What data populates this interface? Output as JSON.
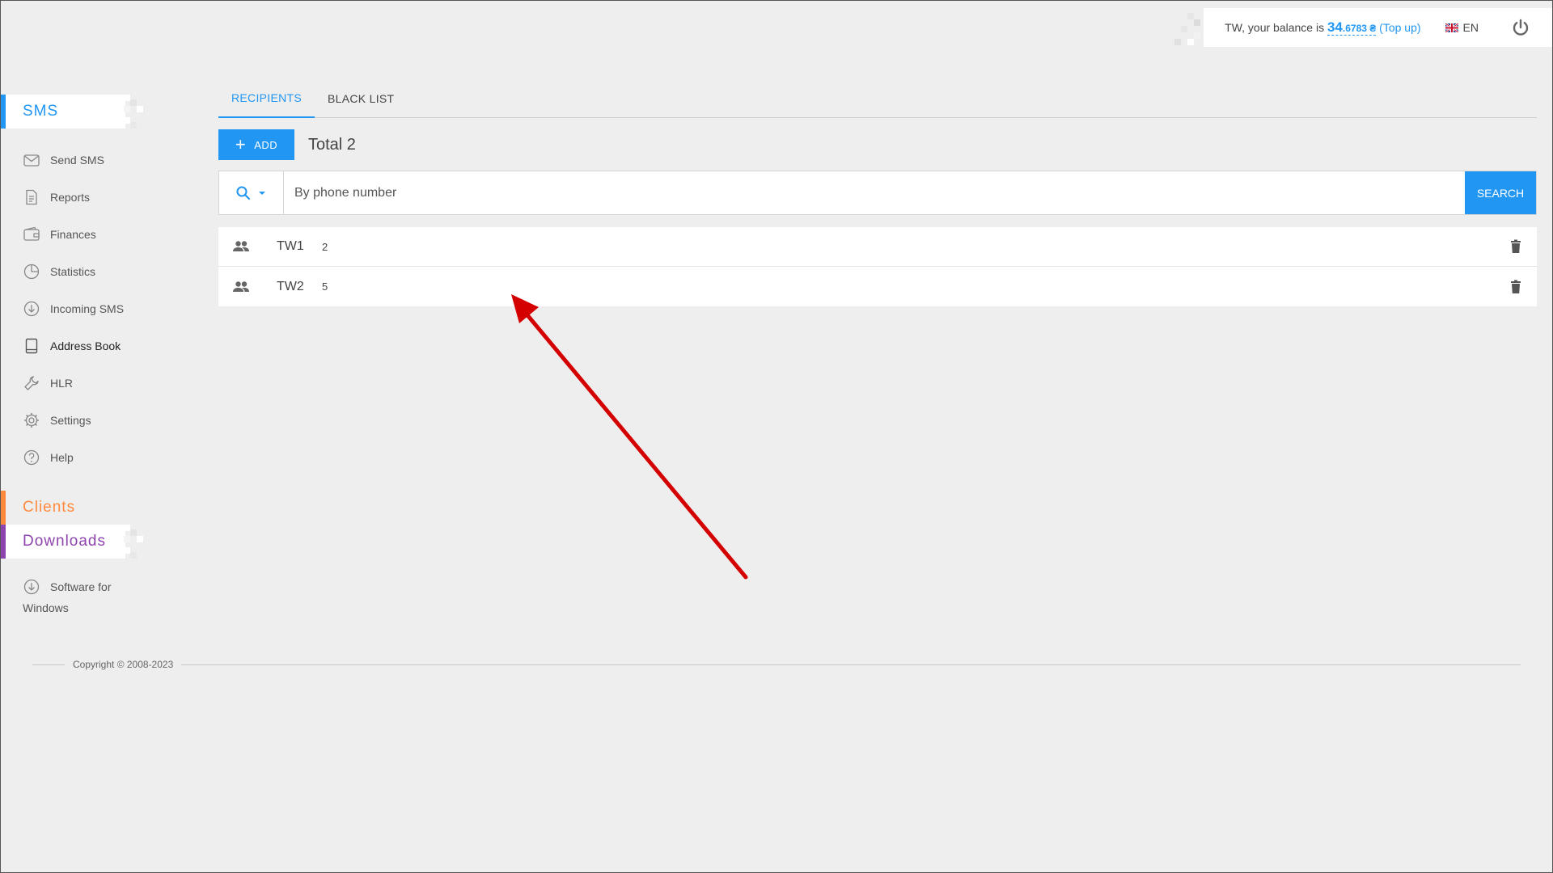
{
  "header": {
    "balance_prefix": "TW, your balance is ",
    "balance_int": "34",
    "balance_dec": ".6783 ₴",
    "topup_open": " (",
    "topup_label": "Top up",
    "topup_close": ")",
    "language": "EN",
    "icons": {
      "flag": "uk-flag-icon",
      "logout": "power-icon"
    }
  },
  "sidebar": {
    "sections": [
      {
        "label": "SMS",
        "color": "#2196f3"
      },
      {
        "label": "Clients",
        "color": "#ff8a3d"
      },
      {
        "label": "Downloads",
        "color": "#8e44ad"
      }
    ],
    "sms_items": [
      {
        "label": "Send SMS",
        "icon": "envelope-icon"
      },
      {
        "label": "Reports",
        "icon": "document-icon"
      },
      {
        "label": "Finances",
        "icon": "wallet-icon"
      },
      {
        "label": "Statistics",
        "icon": "pie-chart-icon"
      },
      {
        "label": "Incoming SMS",
        "icon": "incoming-icon"
      },
      {
        "label": "Address Book",
        "icon": "address-book-icon",
        "active": true
      },
      {
        "label": "HLR",
        "icon": "wrench-icon"
      },
      {
        "label": "Settings",
        "icon": "gear-icon"
      },
      {
        "label": "Help",
        "icon": "help-icon"
      }
    ],
    "downloads_items": [
      {
        "label_line1": "Software for",
        "label_line2": "Windows",
        "icon": "download-icon"
      }
    ]
  },
  "main": {
    "tabs": [
      {
        "label": "RECIPIENTS",
        "active": true
      },
      {
        "label": "BLACK LIST",
        "active": false
      }
    ],
    "add_label": "ADD",
    "total_label": "Total 2",
    "search": {
      "placeholder": "By phone number",
      "button": "SEARCH"
    },
    "groups": [
      {
        "name": "TW1",
        "count": "2"
      },
      {
        "name": "TW2",
        "count": "5"
      }
    ]
  },
  "footer": {
    "copyright": "Copyright © 2008-2023"
  },
  "colors": {
    "accent": "#2196f3",
    "annotation_arrow": "#d40000"
  }
}
